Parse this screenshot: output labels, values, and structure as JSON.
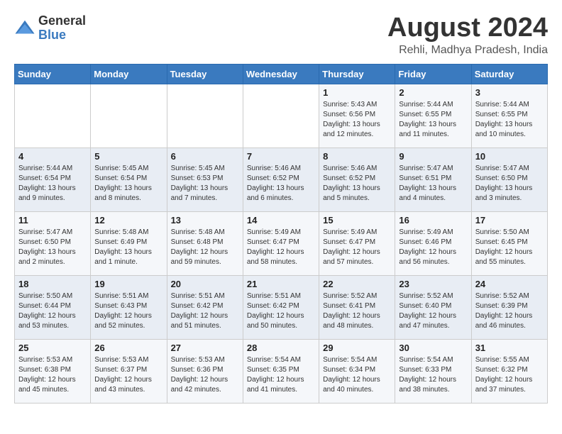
{
  "logo": {
    "general": "General",
    "blue": "Blue"
  },
  "header": {
    "month_year": "August 2024",
    "location": "Rehli, Madhya Pradesh, India"
  },
  "weekdays": [
    "Sunday",
    "Monday",
    "Tuesday",
    "Wednesday",
    "Thursday",
    "Friday",
    "Saturday"
  ],
  "weeks": [
    [
      {
        "day": "",
        "detail": ""
      },
      {
        "day": "",
        "detail": ""
      },
      {
        "day": "",
        "detail": ""
      },
      {
        "day": "",
        "detail": ""
      },
      {
        "day": "1",
        "detail": "Sunrise: 5:43 AM\nSunset: 6:56 PM\nDaylight: 13 hours\nand 12 minutes."
      },
      {
        "day": "2",
        "detail": "Sunrise: 5:44 AM\nSunset: 6:55 PM\nDaylight: 13 hours\nand 11 minutes."
      },
      {
        "day": "3",
        "detail": "Sunrise: 5:44 AM\nSunset: 6:55 PM\nDaylight: 13 hours\nand 10 minutes."
      }
    ],
    [
      {
        "day": "4",
        "detail": "Sunrise: 5:44 AM\nSunset: 6:54 PM\nDaylight: 13 hours\nand 9 minutes."
      },
      {
        "day": "5",
        "detail": "Sunrise: 5:45 AM\nSunset: 6:54 PM\nDaylight: 13 hours\nand 8 minutes."
      },
      {
        "day": "6",
        "detail": "Sunrise: 5:45 AM\nSunset: 6:53 PM\nDaylight: 13 hours\nand 7 minutes."
      },
      {
        "day": "7",
        "detail": "Sunrise: 5:46 AM\nSunset: 6:52 PM\nDaylight: 13 hours\nand 6 minutes."
      },
      {
        "day": "8",
        "detail": "Sunrise: 5:46 AM\nSunset: 6:52 PM\nDaylight: 13 hours\nand 5 minutes."
      },
      {
        "day": "9",
        "detail": "Sunrise: 5:47 AM\nSunset: 6:51 PM\nDaylight: 13 hours\nand 4 minutes."
      },
      {
        "day": "10",
        "detail": "Sunrise: 5:47 AM\nSunset: 6:50 PM\nDaylight: 13 hours\nand 3 minutes."
      }
    ],
    [
      {
        "day": "11",
        "detail": "Sunrise: 5:47 AM\nSunset: 6:50 PM\nDaylight: 13 hours\nand 2 minutes."
      },
      {
        "day": "12",
        "detail": "Sunrise: 5:48 AM\nSunset: 6:49 PM\nDaylight: 13 hours\nand 1 minute."
      },
      {
        "day": "13",
        "detail": "Sunrise: 5:48 AM\nSunset: 6:48 PM\nDaylight: 12 hours\nand 59 minutes."
      },
      {
        "day": "14",
        "detail": "Sunrise: 5:49 AM\nSunset: 6:47 PM\nDaylight: 12 hours\nand 58 minutes."
      },
      {
        "day": "15",
        "detail": "Sunrise: 5:49 AM\nSunset: 6:47 PM\nDaylight: 12 hours\nand 57 minutes."
      },
      {
        "day": "16",
        "detail": "Sunrise: 5:49 AM\nSunset: 6:46 PM\nDaylight: 12 hours\nand 56 minutes."
      },
      {
        "day": "17",
        "detail": "Sunrise: 5:50 AM\nSunset: 6:45 PM\nDaylight: 12 hours\nand 55 minutes."
      }
    ],
    [
      {
        "day": "18",
        "detail": "Sunrise: 5:50 AM\nSunset: 6:44 PM\nDaylight: 12 hours\nand 53 minutes."
      },
      {
        "day": "19",
        "detail": "Sunrise: 5:51 AM\nSunset: 6:43 PM\nDaylight: 12 hours\nand 52 minutes."
      },
      {
        "day": "20",
        "detail": "Sunrise: 5:51 AM\nSunset: 6:42 PM\nDaylight: 12 hours\nand 51 minutes."
      },
      {
        "day": "21",
        "detail": "Sunrise: 5:51 AM\nSunset: 6:42 PM\nDaylight: 12 hours\nand 50 minutes."
      },
      {
        "day": "22",
        "detail": "Sunrise: 5:52 AM\nSunset: 6:41 PM\nDaylight: 12 hours\nand 48 minutes."
      },
      {
        "day": "23",
        "detail": "Sunrise: 5:52 AM\nSunset: 6:40 PM\nDaylight: 12 hours\nand 47 minutes."
      },
      {
        "day": "24",
        "detail": "Sunrise: 5:52 AM\nSunset: 6:39 PM\nDaylight: 12 hours\nand 46 minutes."
      }
    ],
    [
      {
        "day": "25",
        "detail": "Sunrise: 5:53 AM\nSunset: 6:38 PM\nDaylight: 12 hours\nand 45 minutes."
      },
      {
        "day": "26",
        "detail": "Sunrise: 5:53 AM\nSunset: 6:37 PM\nDaylight: 12 hours\nand 43 minutes."
      },
      {
        "day": "27",
        "detail": "Sunrise: 5:53 AM\nSunset: 6:36 PM\nDaylight: 12 hours\nand 42 minutes."
      },
      {
        "day": "28",
        "detail": "Sunrise: 5:54 AM\nSunset: 6:35 PM\nDaylight: 12 hours\nand 41 minutes."
      },
      {
        "day": "29",
        "detail": "Sunrise: 5:54 AM\nSunset: 6:34 PM\nDaylight: 12 hours\nand 40 minutes."
      },
      {
        "day": "30",
        "detail": "Sunrise: 5:54 AM\nSunset: 6:33 PM\nDaylight: 12 hours\nand 38 minutes."
      },
      {
        "day": "31",
        "detail": "Sunrise: 5:55 AM\nSunset: 6:32 PM\nDaylight: 12 hours\nand 37 minutes."
      }
    ]
  ]
}
